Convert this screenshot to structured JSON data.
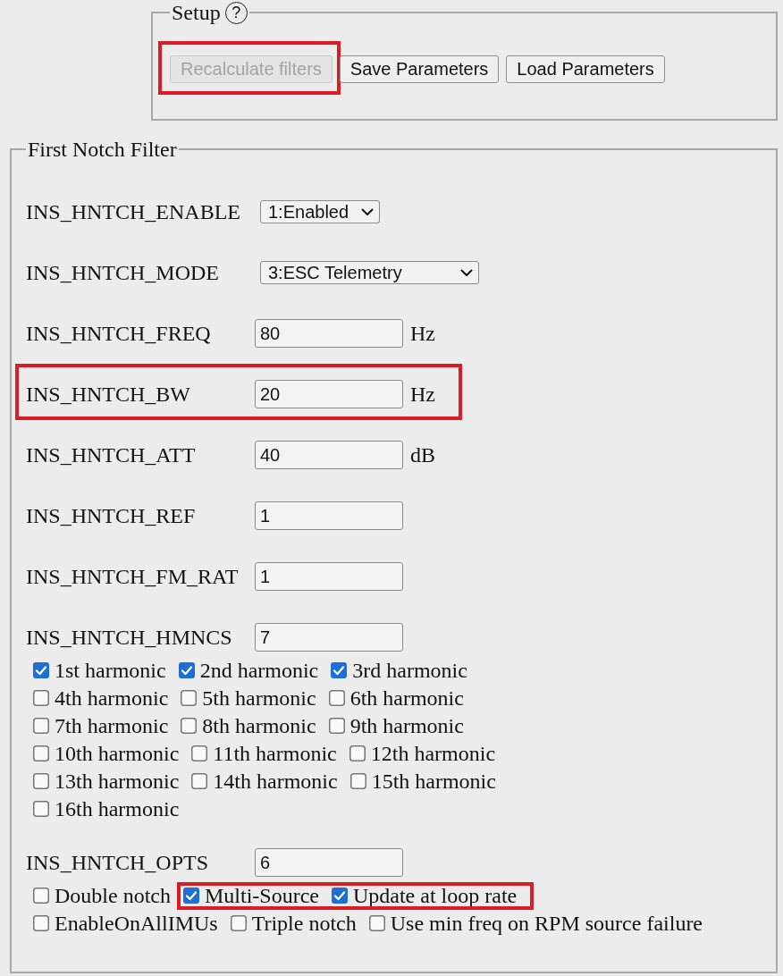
{
  "setup": {
    "title": "Setup",
    "help": "?",
    "buttons": [
      {
        "label": "Recalculate filters",
        "disabled": true,
        "highlighted": true
      },
      {
        "label": "Save Parameters",
        "disabled": false,
        "highlighted": false
      },
      {
        "label": "Load Parameters",
        "disabled": false,
        "highlighted": false
      }
    ]
  },
  "notch_filter": {
    "title": "First Notch Filter",
    "params": [
      {
        "kind": "select",
        "name": "INS_HNTCH_ENABLE",
        "value": "1:Enabled",
        "highlighted": false
      },
      {
        "kind": "select",
        "name": "INS_HNTCH_MODE",
        "value": "3:ESC Telemetry",
        "highlighted": false
      },
      {
        "kind": "input",
        "name": "INS_HNTCH_FREQ",
        "value": "80",
        "unit": "Hz",
        "highlighted": false
      },
      {
        "kind": "input",
        "name": "INS_HNTCH_BW",
        "value": "20",
        "unit": "Hz",
        "highlighted": true
      },
      {
        "kind": "input",
        "name": "INS_HNTCH_ATT",
        "value": "40",
        "unit": "dB",
        "highlighted": false
      },
      {
        "kind": "input",
        "name": "INS_HNTCH_REF",
        "value": "1",
        "highlighted": false
      },
      {
        "kind": "input",
        "name": "INS_HNTCH_FM_RAT",
        "value": "1",
        "highlighted": false
      },
      {
        "kind": "input",
        "name": "INS_HNTCH_HMNCS",
        "value": "7",
        "highlighted": false,
        "checkbox_rows": [
          {
            "items": [
              {
                "label": "1st harmonic",
                "checked": true,
                "highlighted": false
              },
              {
                "label": "2nd harmonic",
                "checked": true,
                "highlighted": false
              },
              {
                "label": "3rd harmonic",
                "checked": true,
                "highlighted": false
              }
            ]
          },
          {
            "items": [
              {
                "label": "4th harmonic",
                "checked": false,
                "highlighted": false
              },
              {
                "label": "5th harmonic",
                "checked": false,
                "highlighted": false
              },
              {
                "label": "6th harmonic",
                "checked": false,
                "highlighted": false
              }
            ]
          },
          {
            "items": [
              {
                "label": "7th harmonic",
                "checked": false,
                "highlighted": false
              },
              {
                "label": "8th harmonic",
                "checked": false,
                "highlighted": false
              },
              {
                "label": "9th harmonic",
                "checked": false,
                "highlighted": false
              }
            ]
          },
          {
            "items": [
              {
                "label": "10th harmonic",
                "checked": false,
                "highlighted": false
              },
              {
                "label": "11th harmonic",
                "checked": false,
                "highlighted": false
              },
              {
                "label": "12th harmonic",
                "checked": false,
                "highlighted": false
              }
            ]
          },
          {
            "items": [
              {
                "label": "13th harmonic",
                "checked": false,
                "highlighted": false
              },
              {
                "label": "14th harmonic",
                "checked": false,
                "highlighted": false
              },
              {
                "label": "15th harmonic",
                "checked": false,
                "highlighted": false
              }
            ]
          },
          {
            "items": [
              {
                "label": "16th harmonic",
                "checked": false,
                "highlighted": false
              }
            ]
          }
        ]
      },
      {
        "kind": "input",
        "name": "INS_HNTCH_OPTS",
        "value": "6",
        "highlighted": false,
        "checkbox_rows": [
          {
            "items": [
              {
                "label": "Double notch",
                "checked": false,
                "highlighted": false
              },
              {
                "label": "Multi-Source",
                "checked": true,
                "highlighted": true
              },
              {
                "label": "Update at loop rate",
                "checked": true,
                "highlighted": true
              }
            ]
          },
          {
            "items": [
              {
                "label": "EnableOnAllIMUs",
                "checked": false,
                "highlighted": false
              },
              {
                "label": "Triple notch",
                "checked": false,
                "highlighted": false
              },
              {
                "label": "Use min freq on RPM source failure",
                "checked": false,
                "highlighted": false
              }
            ]
          }
        ]
      }
    ]
  }
}
